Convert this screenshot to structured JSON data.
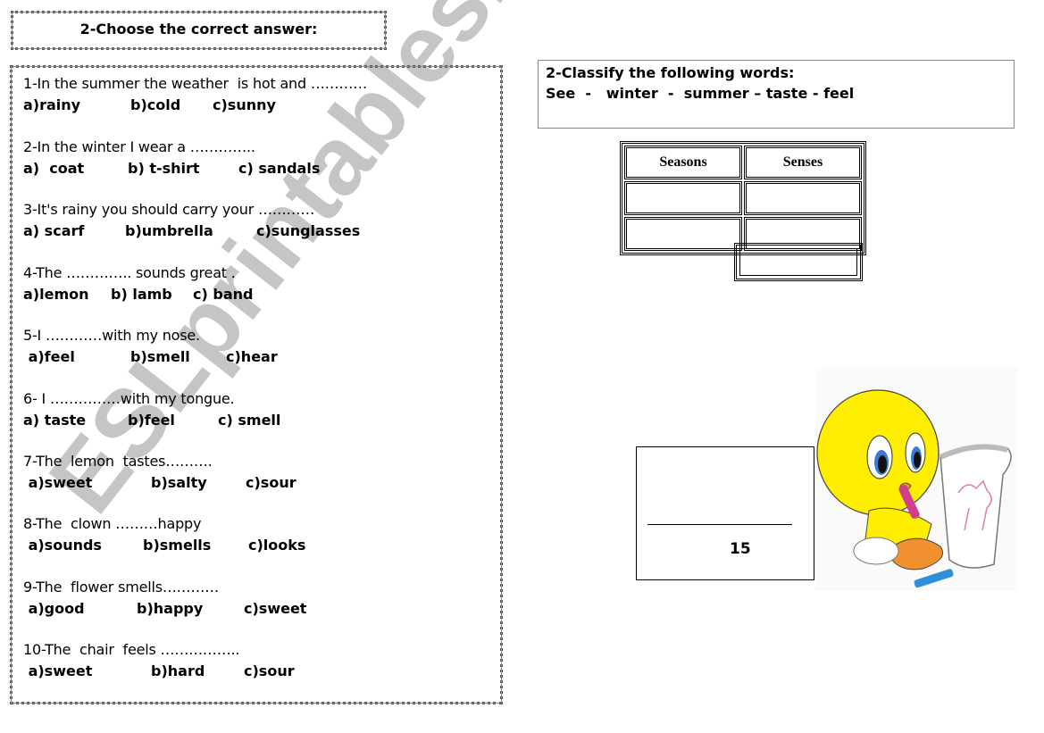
{
  "section1": {
    "title": "2-Choose the correct answer:",
    "questions": [
      {
        "stem": "1-In the summer the weather  is hot and …………",
        "options": [
          "a)rainy",
          "b)cold",
          "c)sunny"
        ]
      },
      {
        "stem": "2-In the winter I wear a …………..",
        "options": [
          "a)  coat",
          "b) t-shirt",
          "c) sandals"
        ]
      },
      {
        "stem": "3-It's rainy you should carry your …………",
        "options": [
          "a) scarf",
          "b)umbrella",
          "c)sunglasses"
        ]
      },
      {
        "stem": "4-The ………….. sounds great .",
        "options": [
          "a)lemon",
          "b) lamb",
          "c) band"
        ]
      },
      {
        "stem": "5-I …………with my nose.",
        "options": [
          " a)feel",
          "b)smell",
          "c)hear"
        ]
      },
      {
        "stem": "6- I ……………with my tongue.",
        "options": [
          "a) taste",
          "b)feel",
          "c) smell"
        ]
      },
      {
        "stem": "7-The  lemon  tastes……….",
        "options": [
          " a)sweet",
          "b)salty",
          "c)sour"
        ]
      },
      {
        "stem": "8-The  clown ………happy",
        "options": [
          " a)sounds",
          "b)smells",
          "c)looks"
        ]
      },
      {
        "stem": "9-The  flower smells…………",
        "options": [
          " a)good",
          "b)happy",
          "c)sweet"
        ]
      },
      {
        "stem": "10-The  chair  feels ……………..",
        "options": [
          " a)sweet",
          "b)hard",
          "c)sour"
        ]
      }
    ]
  },
  "section2": {
    "title": "2-Classify the following words:",
    "words": "See  -   winter  -  summer – taste - feel",
    "table": {
      "headers": [
        "Seasons",
        "Senses"
      ],
      "rows": [
        [
          "",
          ""
        ],
        [
          "",
          ""
        ]
      ],
      "extra_cell": ""
    }
  },
  "score": {
    "total": "15"
  },
  "picture": {
    "description": "Tweety bird drawing a cat on a sketch pad with a crayon"
  },
  "watermark": "ESLprintables.com"
}
